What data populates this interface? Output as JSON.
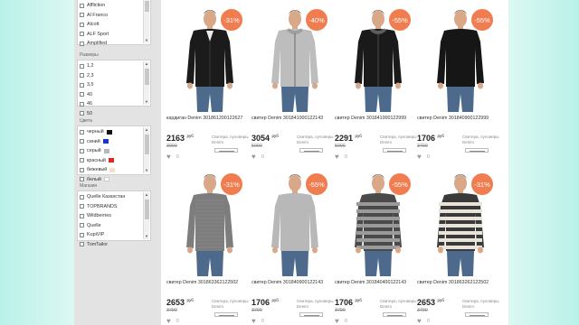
{
  "brands": {
    "title": "",
    "items": [
      "Affliction",
      "Al Franco",
      "Alcott",
      "ALF Sport",
      "Amplified"
    ]
  },
  "sizes": {
    "title": "Размеры",
    "items": [
      "1,2",
      "2,3",
      "3,5",
      "40",
      "46",
      "50"
    ]
  },
  "colors": {
    "title": "Цвета",
    "items": [
      {
        "label": "черный",
        "swatch": "#111111"
      },
      {
        "label": "синий",
        "swatch": "#1e32d2"
      },
      {
        "label": "серый",
        "swatch": "#b8b8b8"
      },
      {
        "label": "красный",
        "swatch": "#e0261f"
      },
      {
        "label": "бежевый",
        "swatch": "#f2e2c4"
      },
      {
        "label": "белый",
        "swatch": "#ffffff"
      }
    ]
  },
  "shops": {
    "title": "Магазин",
    "items": [
      "Quelle Казахстан",
      "TOPBRANDS",
      "Wildberries",
      "Quelle",
      "KupiVIP",
      "TomTailor"
    ]
  },
  "currency": "руб",
  "category_text": "Свитера, пуловеры Denim",
  "products": [
    {
      "name": "кардиган Denim 301861200122627",
      "price": "2163",
      "old": "3090",
      "discount": "-31%",
      "color": "#1b1b1b",
      "skin": "#d9a888",
      "type": "cardigan",
      "likes": "0"
    },
    {
      "name": "свитер Denim 301841000122143",
      "price": "3054",
      "old": "5090",
      "discount": "-40%",
      "color": "#bdbdbd",
      "skin": "#d9a888",
      "type": "hoodie",
      "likes": "0"
    },
    {
      "name": "свитер Denim 301841000122999",
      "price": "2291",
      "old": "5090",
      "discount": "-55%",
      "color": "#1a1a1a",
      "skin": "#d9a888",
      "type": "hoodie",
      "likes": "0"
    },
    {
      "name": "свитер Denim 301840900122999",
      "price": "1706",
      "old": "3790",
      "discount": "-55%",
      "color": "#161616",
      "skin": "#d9a888",
      "type": "sweater",
      "likes": "0"
    },
    {
      "name": "свитер Denim 301863362122502",
      "price": "2653",
      "old": "3790",
      "discount": "-31%",
      "color": "#7d7d7d",
      "skin": "#d9a888",
      "type": "knit",
      "likes": "0"
    },
    {
      "name": "свитер Denim 301840900122143",
      "price": "1706",
      "old": "3790",
      "discount": "-55%",
      "color": "#b8b8b8",
      "skin": "#d9a888",
      "type": "sweater",
      "likes": "0"
    },
    {
      "name": "свитер Denim 301840400122143",
      "price": "1706",
      "old": "3790",
      "discount": "-55%",
      "color": "#4a4a4a",
      "skin": "#d9a888",
      "type": "stripe-dark",
      "likes": "0"
    },
    {
      "name": "свитер Denim 301863262122502",
      "price": "2653",
      "old": "3790",
      "discount": "-31%",
      "color": "#3a3a3a",
      "skin": "#d9a888",
      "type": "stripe-light",
      "likes": "0"
    }
  ]
}
